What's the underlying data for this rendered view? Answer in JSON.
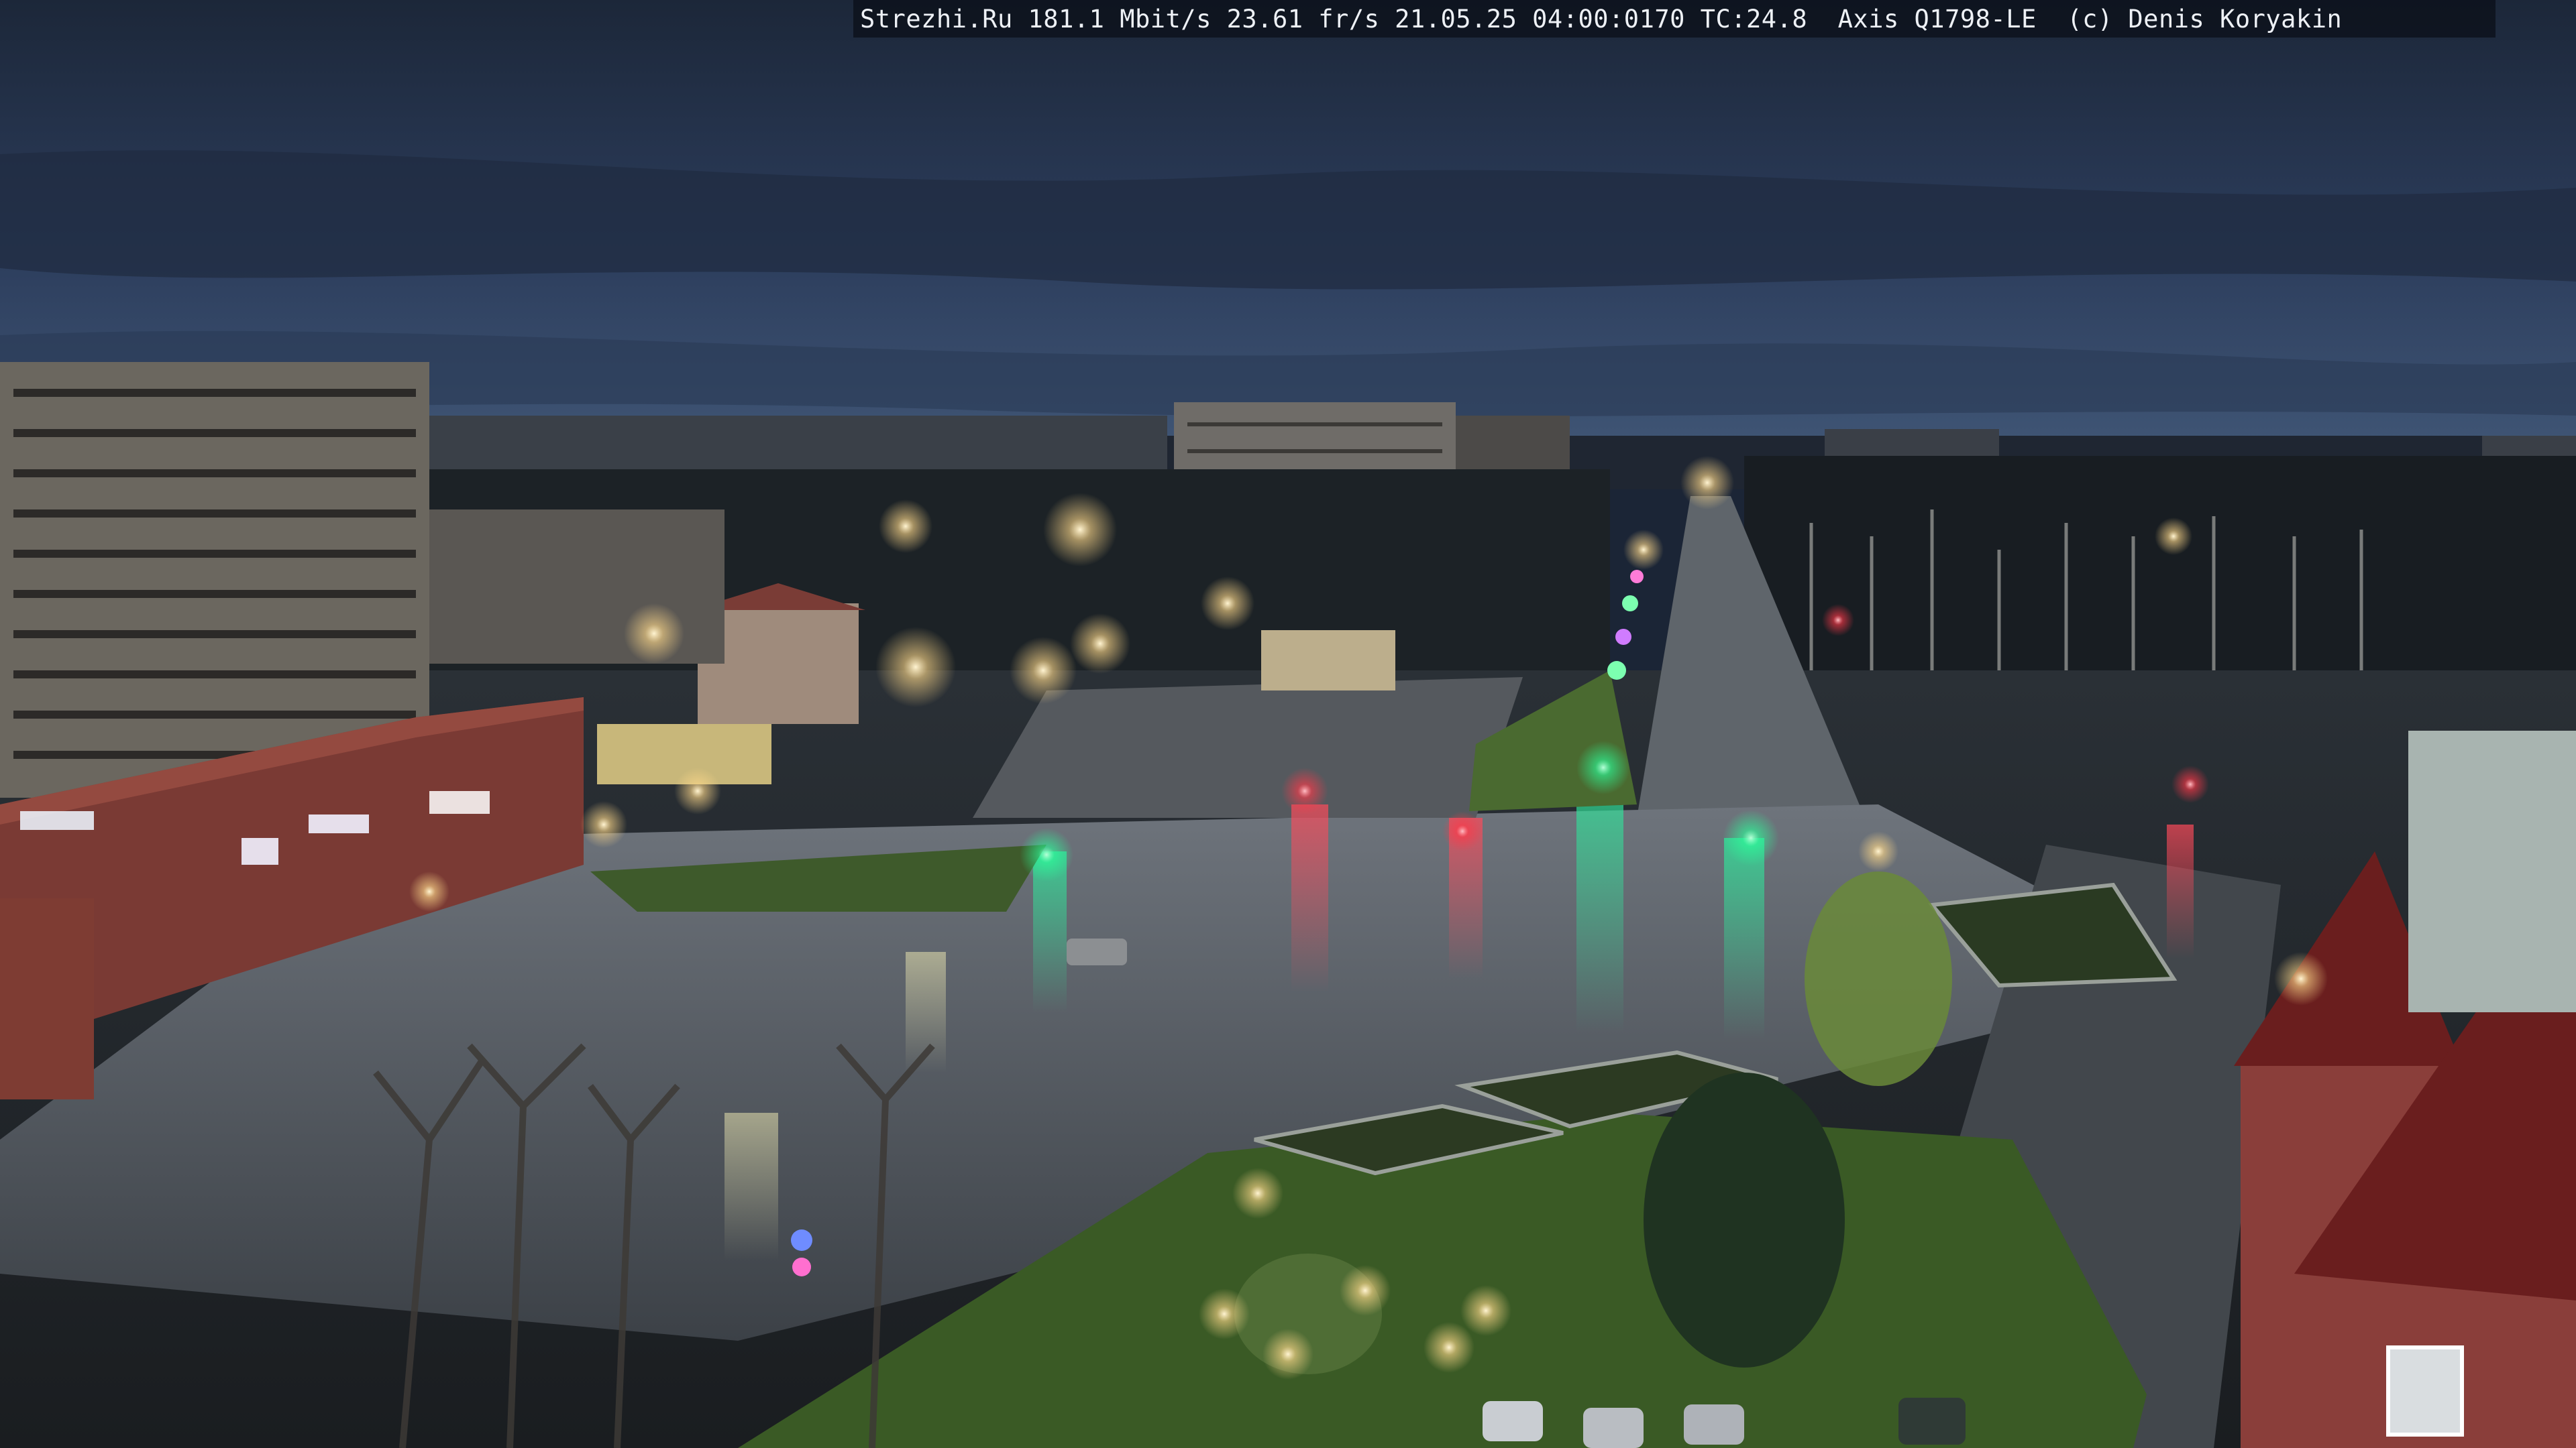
{
  "camera_overlay": {
    "text": "Strezhi.Ru 181.1 Mbit/s 23.61 fr/s 21.05.25 04:00:0170 TC:24.8  Axis Q1798-LE  (c) Denis Koryakin"
  },
  "scene": {
    "description_colors": {
      "sky_top": "#1e2a3f",
      "sky_horizon": "#3a4f73",
      "asphalt_wet": "#3b4046",
      "grass": "#3f5a2c",
      "building_brick": "#7a3a34",
      "light_green": "#2bff9a",
      "light_red": "#ff3848",
      "lamp_warm": "#ffe6a8"
    }
  }
}
